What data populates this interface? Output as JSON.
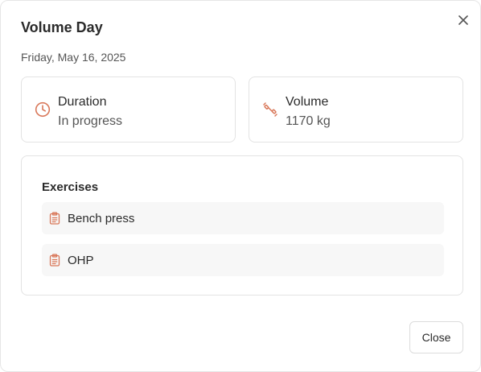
{
  "dialog": {
    "title": "Volume Day",
    "date": "Friday, May 16, 2025",
    "close_icon": "close-icon",
    "close_button_label": "Close"
  },
  "stats": {
    "duration": {
      "icon": "clock-icon",
      "label": "Duration",
      "value": "In progress"
    },
    "volume": {
      "icon": "dumbbell-icon",
      "label": "Volume",
      "value": "1170 kg"
    }
  },
  "exercises": {
    "heading": "Exercises",
    "item_icon": "clipboard-icon",
    "items": [
      {
        "label": "Bench press"
      },
      {
        "label": "OHP"
      }
    ]
  },
  "colors": {
    "accent": "#d9785a",
    "card_border": "#e3e3e3",
    "item_background": "#f7f7f7"
  }
}
